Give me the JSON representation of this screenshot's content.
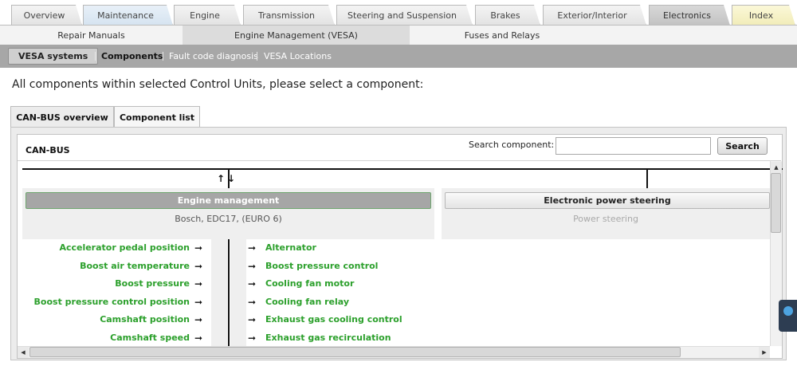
{
  "top_tabs": [
    {
      "label": "Overview"
    },
    {
      "label": "Maintenance"
    },
    {
      "label": "Engine"
    },
    {
      "label": "Transmission"
    },
    {
      "label": "Steering and Suspension"
    },
    {
      "label": "Brakes"
    },
    {
      "label": "Exterior/Interior"
    },
    {
      "label": "Electronics"
    },
    {
      "label": "Index"
    }
  ],
  "sub_tabs": [
    {
      "label": "Repair Manuals"
    },
    {
      "label": "Engine Management (VESA)"
    },
    {
      "label": "Fuses and Relays"
    }
  ],
  "nav": {
    "vesa_systems": "VESA systems",
    "components": "Components",
    "fault_code": "Fault code diagnosis",
    "locations": "VESA Locations"
  },
  "heading": "All components within selected Control Units, please select a component:",
  "panel_tabs": [
    {
      "label": "CAN-BUS overview"
    },
    {
      "label": "Component list"
    }
  ],
  "canbus_label": "CAN-BUS",
  "search": {
    "label": "Search component:",
    "value": "",
    "button": "Search"
  },
  "arrows_label": "↑↓",
  "units": [
    {
      "title": "Engine management",
      "subtitle": "Bosch, EDC17, (EURO 6)"
    },
    {
      "title": "Electronic power steering",
      "subtitle": "Power steering"
    }
  ],
  "inputs": [
    "Accelerator pedal position",
    "Boost air temperature",
    "Boost pressure",
    "Boost pressure control position",
    "Camshaft position",
    "Camshaft speed"
  ],
  "outputs": [
    "Alternator",
    "Boost pressure control",
    "Cooling fan motor",
    "Cooling fan relay",
    "Exhaust gas cooling control",
    "Exhaust gas recirculation"
  ],
  "arrow_glyph": "➞",
  "colors": {
    "component_green": "#2ca02c",
    "navbar_grey": "#a7a7a7"
  }
}
